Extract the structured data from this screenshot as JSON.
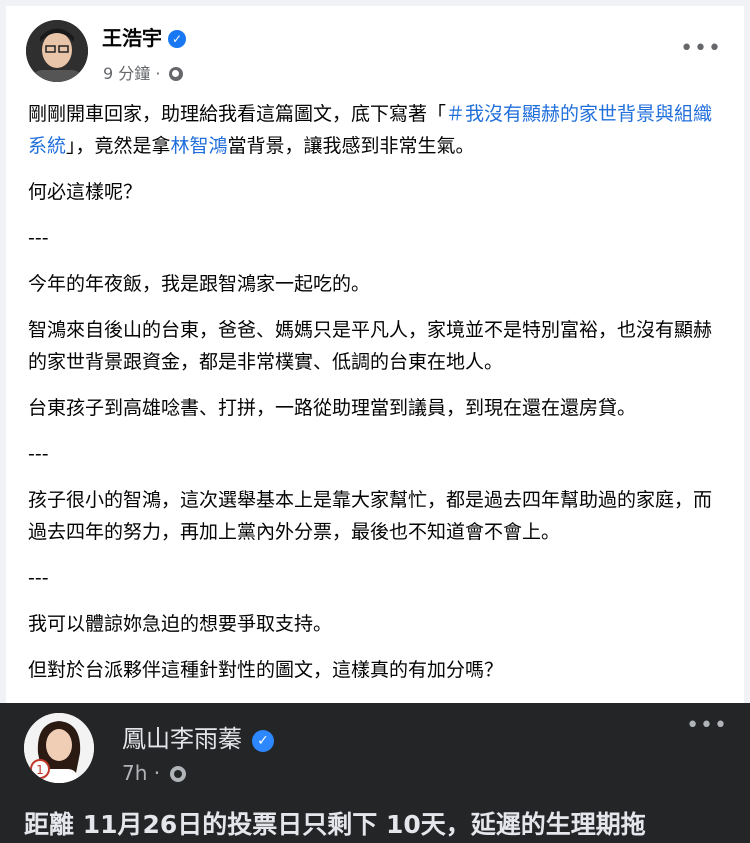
{
  "post": {
    "author": "王浩宇",
    "time": "9 分鐘",
    "separator": "·",
    "more_icon": "more-horizontal-icon",
    "paragraphs": {
      "p1_a": "剛剛開車回家，助理給我看這篇圖文，底下寫著「",
      "p1_link1": "＃我沒有顯赫的家世背景與組織系統",
      "p1_b": "」，竟然是拿",
      "p1_link2": "林智鴻",
      "p1_c": "當背景，讓我感到非常生氣。",
      "p2": "何必這樣呢？",
      "sep1": "---",
      "p3": "今年的年夜飯，我是跟智鴻家一起吃的。",
      "p4": "智鴻來自後山的台東，爸爸、媽媽只是平凡人，家境並不是特別富裕，也沒有顯赫的家世背景跟資金，都是非常樸實、低調的台東在地人。",
      "p5": "台東孩子到高雄唸書、打拼，一路從助理當到議員，到現在還在還房貸。",
      "sep2": "---",
      "p6": "孩子很小的智鴻，這次選舉基本上是靠大家幫忙，都是過去四年幫助過的家庭，而過去四年的努力，再加上黨內外分票，最後也不知道會不會上。",
      "sep3": "---",
      "p7": "我可以體諒妳急迫的想要爭取支持。",
      "p8": "但對於台派夥伴這種針對性的圖文，這樣真的有加分嗎？"
    }
  },
  "shared": {
    "author": "鳳山李雨蓁",
    "time": "7h",
    "separator": "·",
    "badge_number": "1",
    "text": "距離 11月26日的投票日只剩下 10天，延遲的生理期拖"
  },
  "colors": {
    "link": "#216fdb",
    "verified": "#1877f2",
    "dark_bg": "#242526"
  }
}
